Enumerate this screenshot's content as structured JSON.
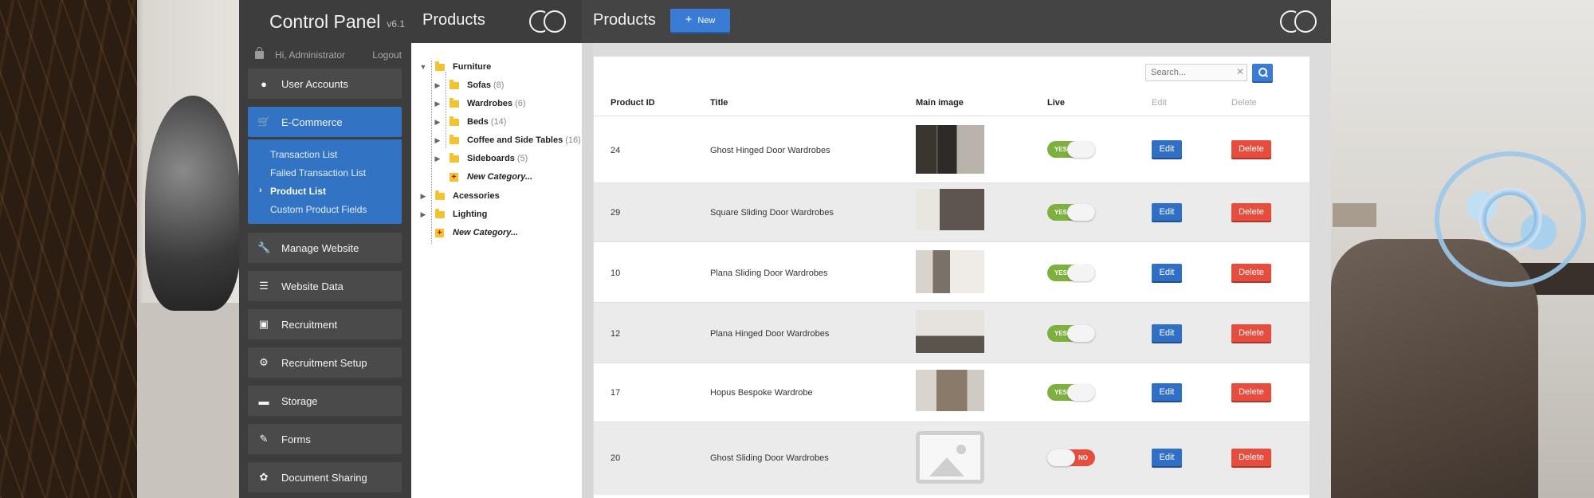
{
  "sidebar": {
    "title": "Control Panel",
    "version": "v6.1",
    "greeting": "Hi, Administrator",
    "logout": "Logout",
    "items": [
      {
        "label": "User Accounts",
        "icon": "user-icon"
      },
      {
        "label": "E-Commerce",
        "icon": "cart-icon",
        "active": true
      },
      {
        "label": "Manage Website",
        "icon": "wrench-icon"
      },
      {
        "label": "Website Data",
        "icon": "list-icon"
      },
      {
        "label": "Recruitment",
        "icon": "briefcase-icon"
      },
      {
        "label": "Recruitment Setup",
        "icon": "gear-icon"
      },
      {
        "label": "Storage",
        "icon": "hdd-icon"
      },
      {
        "label": "Forms",
        "icon": "pencil-icon"
      },
      {
        "label": "Document Sharing",
        "icon": "share-icon"
      }
    ],
    "submenu": [
      {
        "label": "Transaction List"
      },
      {
        "label": "Failed Transaction List"
      },
      {
        "label": "Product List",
        "current": true
      },
      {
        "label": "Custom Product Fields"
      }
    ]
  },
  "tree": {
    "title": "Products",
    "root": {
      "label": "Furniture"
    },
    "children": [
      {
        "label": "Sofas",
        "count": "(8)"
      },
      {
        "label": "Wardrobes",
        "count": "(6)"
      },
      {
        "label": "Beds",
        "count": "(14)"
      },
      {
        "label": "Coffee and Side Tables",
        "count": "(16)"
      },
      {
        "label": "Sideboards",
        "count": "(5)"
      }
    ],
    "new_category_child": "New Category...",
    "siblings": [
      {
        "label": "Acessories"
      },
      {
        "label": "Lighting"
      }
    ],
    "new_category_root": "New Category..."
  },
  "main": {
    "title": "Products",
    "new_label": "New",
    "search_placeholder": "Search...",
    "columns": [
      "Product ID",
      "Title",
      "Main image",
      "Live",
      "Edit",
      "Delete"
    ],
    "rows": [
      {
        "id": "24",
        "title": "Ghost Hinged Door Wardrobes",
        "live": "YES",
        "edit": "Edit",
        "delete": "Delete"
      },
      {
        "id": "29",
        "title": "Square Sliding Door Wardrobes",
        "live": "YES",
        "edit": "Edit",
        "delete": "Delete"
      },
      {
        "id": "10",
        "title": "Plana Sliding Door Wardrobes",
        "live": "YES",
        "edit": "Edit",
        "delete": "Delete"
      },
      {
        "id": "12",
        "title": "Plana Hinged Door Wardrobes",
        "live": "YES",
        "edit": "Edit",
        "delete": "Delete"
      },
      {
        "id": "17",
        "title": "Hopus Bespoke Wardrobe",
        "live": "YES",
        "edit": "Edit",
        "delete": "Delete"
      },
      {
        "id": "20",
        "title": "Ghost Sliding Door Wardrobes",
        "live": "NO",
        "edit": "Edit",
        "delete": "Delete"
      }
    ]
  },
  "colors": {
    "accent": "#3273c4",
    "sidebar_bg": "#3d3d3d",
    "toggle_on": "#7db03e",
    "danger": "#e74c3c"
  }
}
